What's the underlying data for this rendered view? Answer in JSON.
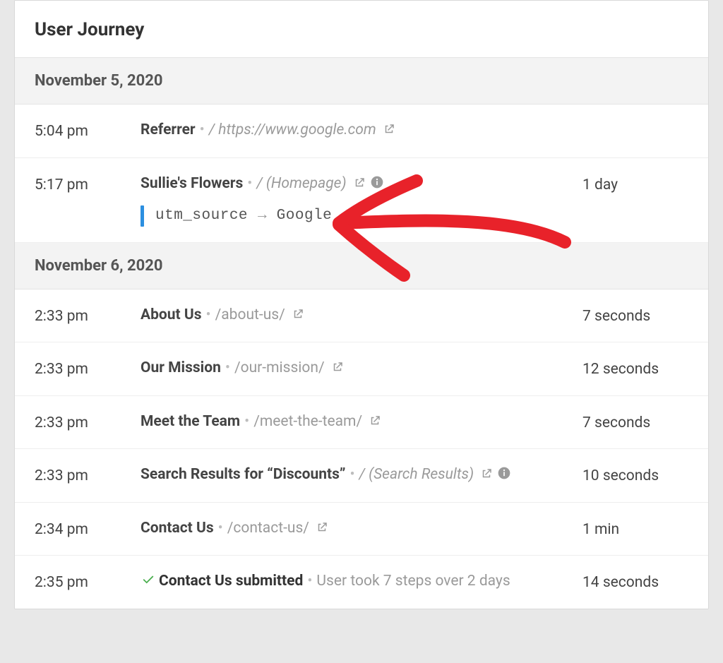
{
  "header": {
    "title": "User Journey"
  },
  "days": [
    {
      "date": "November 5, 2020",
      "rows": [
        {
          "time": "5:04 pm",
          "title": "Referrer",
          "path": "/ https://www.google.com",
          "italic_path": true,
          "ext": true,
          "info": false,
          "check": false,
          "duration": "",
          "utm": null
        },
        {
          "time": "5:17 pm",
          "title": "Sullie's Flowers",
          "path": "/ (Homepage)",
          "italic_path": true,
          "ext": true,
          "info": true,
          "check": false,
          "duration": "1 day",
          "utm": {
            "key": "utm_source",
            "value": "Google"
          }
        }
      ]
    },
    {
      "date": "November 6, 2020",
      "rows": [
        {
          "time": "2:33 pm",
          "title": "About Us",
          "path": "/about-us/",
          "italic_path": false,
          "ext": true,
          "info": false,
          "check": false,
          "duration": "7 seconds",
          "utm": null
        },
        {
          "time": "2:33 pm",
          "title": "Our Mission",
          "path": "/our-mission/",
          "italic_path": false,
          "ext": true,
          "info": false,
          "check": false,
          "duration": "12 seconds",
          "utm": null
        },
        {
          "time": "2:33 pm",
          "title": "Meet the Team",
          "path": "/meet-the-team/",
          "italic_path": false,
          "ext": true,
          "info": false,
          "check": false,
          "duration": "7 seconds",
          "utm": null
        },
        {
          "time": "2:33 pm",
          "title": "Search Results for “Discounts”",
          "path": "/ (Search Results)",
          "italic_path": true,
          "ext": true,
          "info": true,
          "check": false,
          "duration": "10 seconds",
          "utm": null
        },
        {
          "time": "2:34 pm",
          "title": "Contact Us",
          "path": "/contact-us/",
          "italic_path": false,
          "ext": true,
          "info": false,
          "check": false,
          "duration": "1 min",
          "utm": null
        },
        {
          "time": "2:35 pm",
          "title": "Contact Us submitted",
          "path": "User took 7 steps over 2 days",
          "italic_path": false,
          "ext": false,
          "info": false,
          "check": true,
          "duration": "14 seconds",
          "utm": null
        }
      ]
    }
  ]
}
